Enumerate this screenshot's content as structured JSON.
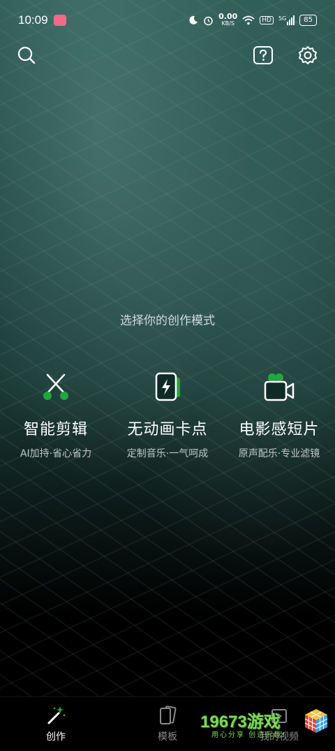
{
  "status_bar": {
    "time": "10:09",
    "net_speed": "0.00",
    "net_unit": "KB/S",
    "hd": "HD",
    "signal": "5G",
    "battery": "85"
  },
  "main": {
    "prompt": "选择你的创作模式",
    "modes": [
      {
        "title": "智能剪辑",
        "subtitle": "AI加持·省心省力"
      },
      {
        "title": "无动画卡点",
        "subtitle": "定制音乐·一气呵成"
      },
      {
        "title": "电影感短片",
        "subtitle": "原声配乐·专业滤镜"
      }
    ]
  },
  "tabbar": {
    "tabs": [
      {
        "label": "创作"
      },
      {
        "label": "模板"
      },
      {
        "label": "我的视频"
      }
    ]
  },
  "watermark": {
    "brand": "19673游戏",
    "tagline": "用心分享 创造乐趣!"
  },
  "colors": {
    "accent_green": "#1fa83d",
    "watermark_green": "#7ed957"
  }
}
